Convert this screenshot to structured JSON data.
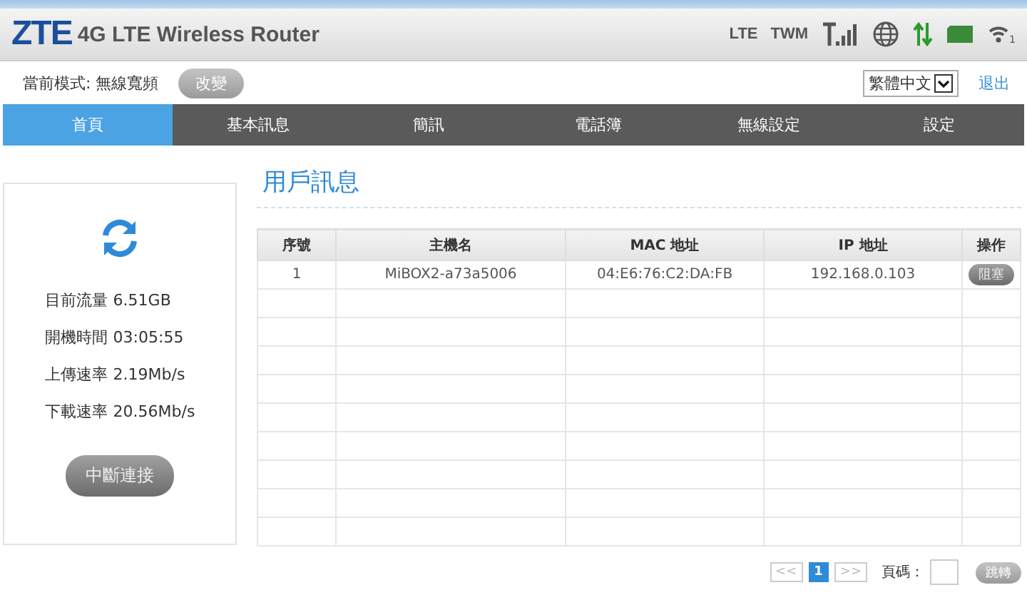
{
  "header": {
    "logo": "ZTE",
    "title": "4G LTE Wireless Router",
    "status": [
      "LTE",
      "TWM"
    ],
    "wifi_clients": "1"
  },
  "mode": {
    "label": "當前模式: 無線寬頻",
    "change_button": "改變",
    "language": "繁體中文",
    "logout": "退出"
  },
  "nav": [
    {
      "label": "首頁",
      "selected": true
    },
    {
      "label": "基本訊息",
      "selected": false
    },
    {
      "label": "簡訊",
      "selected": false
    },
    {
      "label": "電話簿",
      "selected": false
    },
    {
      "label": "無線設定",
      "selected": false
    },
    {
      "label": "設定",
      "selected": false
    }
  ],
  "stats": [
    {
      "label": "目前流量",
      "value": "6.51GB"
    },
    {
      "label": "開機時間",
      "value": "03:05:55"
    },
    {
      "label": "上傳速率",
      "value": "2.19Mb/s"
    },
    {
      "label": "下載速率",
      "value": "20.56Mb/s"
    }
  ],
  "disconnect_button": "中斷連接",
  "section_title": "用戶訊息",
  "table": {
    "columns": [
      "序號",
      "主機名",
      "MAC 地址",
      "IP 地址",
      "操作"
    ],
    "rows": [
      {
        "index": "1",
        "host": "MiBOX2-a73a5006",
        "mac": "04:E6:76:C2:DA:FB",
        "ip": "192.168.0.103",
        "action": "阻塞"
      }
    ]
  },
  "pagination": {
    "prev": "<<",
    "pages": [
      {
        "label": "1",
        "selected": true
      }
    ],
    "next": ">>",
    "page_label": "頁碼：",
    "go_button": "跳轉"
  }
}
